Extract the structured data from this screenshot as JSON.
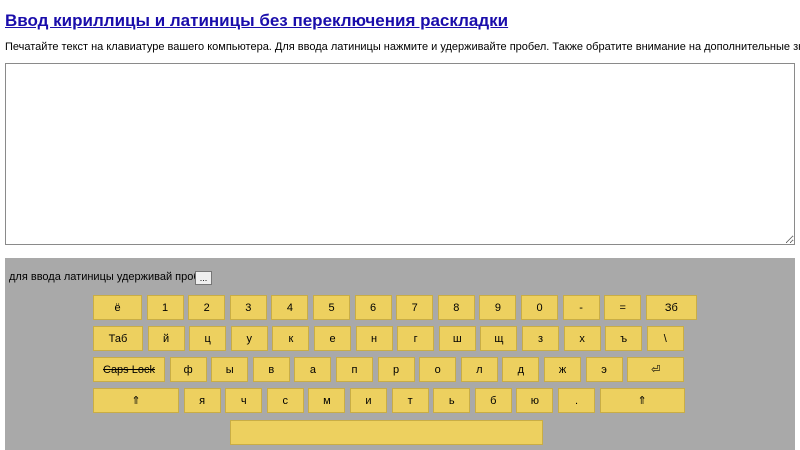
{
  "page": {
    "title": "Ввод кириллицы и латиницы без переключения раскладки",
    "description": "Печатайте текст на клавиатуре вашего компьютера. Для ввода латиницы нажмите и удерживайте пробел. Также обратите внимание на дополнительные значки."
  },
  "text_area": {
    "value": ""
  },
  "keyboard": {
    "hint": "для ввода латиницы удерживай пробел",
    "more_label": "...",
    "rows": [
      [
        "ё",
        "1",
        "2",
        "3",
        "4",
        "5",
        "6",
        "7",
        "8",
        "9",
        "0",
        "-",
        "=",
        "Зб"
      ],
      [
        "Таб",
        "й",
        "ц",
        "у",
        "к",
        "е",
        "н",
        "г",
        "ш",
        "щ",
        "з",
        "х",
        "ъ",
        "\\"
      ],
      [
        "Caps Lock",
        "ф",
        "ы",
        "в",
        "а",
        "п",
        "р",
        "о",
        "л",
        "д",
        "ж",
        "э",
        "⏎"
      ],
      [
        "⇑",
        "я",
        "ч",
        "с",
        "м",
        "и",
        "т",
        "ь",
        "б",
        "ю",
        ".",
        "⇑"
      ],
      [
        ""
      ]
    ]
  }
}
